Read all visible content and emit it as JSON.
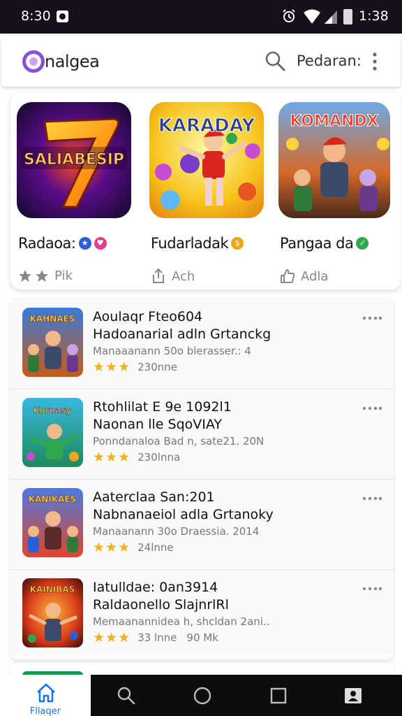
{
  "status_bar": {
    "time": "8:30",
    "battery_text": "1:38"
  },
  "app_bar": {
    "app_name": "nalgea",
    "header_label": "Pedaran:",
    "icons": [
      "logo-icon",
      "search-icon",
      "more-vert-icon"
    ]
  },
  "featured": [
    {
      "title": "Radaoa:",
      "art_text": "SALIABESIP",
      "meta_label": "Pik",
      "meta_icon": "star-rating-icon",
      "badge_colors": [
        "#2a5fd6",
        "#e33b8f"
      ]
    },
    {
      "title": "Fudarladak",
      "art_text": "KARADAY",
      "meta_label": "Ach",
      "meta_icon": "share-icon",
      "badge_colors": [
        "#f0a616"
      ]
    },
    {
      "title": "Pangaa da",
      "art_text": "KOMANDX",
      "meta_label": "Adla",
      "meta_icon": "thumb-up-icon",
      "badge_colors": [
        "#2fa84f"
      ]
    }
  ],
  "list": [
    {
      "title": "Aoulaqr Fteo604",
      "subtitle": "Hadoanarial adln Grtanckg",
      "desc": "Manaaanann 50o blerasser.: 4",
      "rating_text": "230nne",
      "extra": "",
      "art_text": "KAHNAES",
      "stars": 3
    },
    {
      "title": "Rtohlilat E 9e 1092l1",
      "subtitle": "Naonan lle SqoVIAY",
      "desc": "Ponndanaloa Bad n, sate21. 20N",
      "rating_text": "230lnna",
      "extra": "",
      "art_text": "Kornasy",
      "stars": 3
    },
    {
      "title": "Aaterclaa San:201",
      "subtitle": "Nabnanaeiol adla Grtanoky",
      "desc": "Manaanann 30o Draessia. 2014",
      "rating_text": "24lnne",
      "extra": "",
      "art_text": "KANIKAES",
      "stars": 3
    },
    {
      "title": "Iatulldae: 0an3914",
      "subtitle": "Raldaonello SlajnrlRl",
      "desc": "Memaanannidea h, shcldan 2ani..",
      "rating_text": "33 lnne",
      "extra": "90 Mk",
      "art_text": "KAINIBAS",
      "stars": 3
    }
  ],
  "bottom_nav": {
    "home_label": "Fllaqer",
    "icons": [
      "home-icon",
      "search-icon",
      "circle-home-icon",
      "square-recents-icon",
      "account-icon"
    ]
  },
  "colors": {
    "accent": "#8c4fd8",
    "star": "#f2b01e",
    "nav_active": "#1a73e8",
    "status_bar": "#15101a"
  }
}
